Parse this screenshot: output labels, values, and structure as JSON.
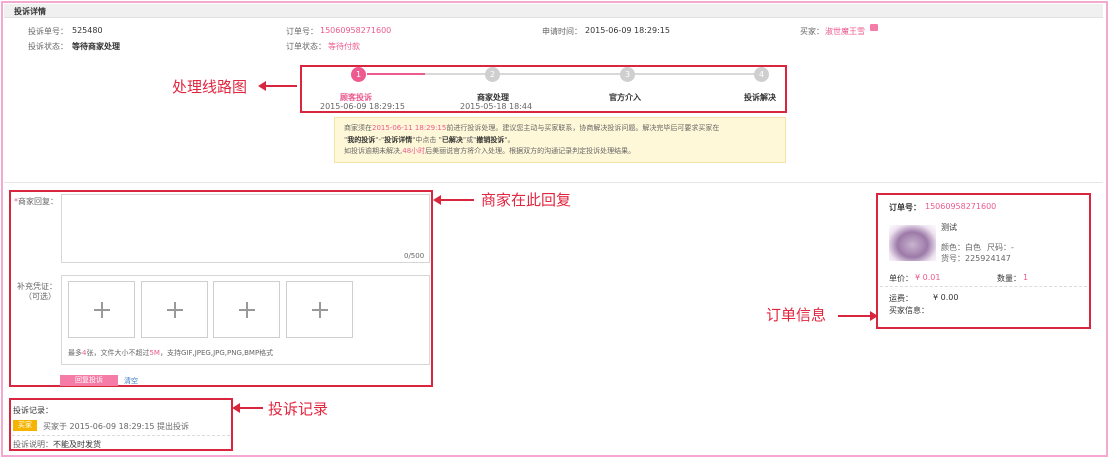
{
  "header": {
    "title": "投诉详情"
  },
  "info": {
    "complaint_no_label": "投诉单号：",
    "complaint_no": "525480",
    "order_no_label": "订单号：",
    "order_no": "15060958271600",
    "apply_time_label": "申请时间：",
    "apply_time": "2015-06-09 18:29:15",
    "buyer_label": "买家：",
    "buyer": "淑世魔王雪",
    "complaint_status_label": "投诉状态：",
    "complaint_status": "等待商家处理",
    "order_status_label": "订单状态：",
    "order_status": "等待付款"
  },
  "steps": [
    {
      "num": "1",
      "label": "顾客投诉",
      "date": "2015-06-09 18:29:15",
      "active": true
    },
    {
      "num": "2",
      "label": "商家处理",
      "date": "2015-05-18 18:44",
      "active": false
    },
    {
      "num": "3",
      "label": "官方介入",
      "date": "",
      "active": false
    },
    {
      "num": "4",
      "label": "投诉解决",
      "date": "",
      "active": false
    }
  ],
  "notice": {
    "l1_a": "商家须在",
    "l1_deadline": "2015-06-11 18:29:15",
    "l1_b": "前进行投诉处理。建议您主动与买家联系，协商解决投诉问题。解决完毕后可要求买家在",
    "l2_a": "\"",
    "l2_b1": "我的投诉",
    "l2_dash": "\"-\"",
    "l2_b2": "投诉详情",
    "l2_c": "\"中点击 \"",
    "l2_b3": "已解决",
    "l2_or": "\"或\"",
    "l2_b4": "撤销投诉",
    "l2_end": "\"。",
    "l3_a": "如投诉逾期未解决,",
    "l3_hours": "48小时",
    "l3_b": "后美丽说官方将介入处理。根据双方的沟通记录判定投诉处理结果。"
  },
  "reply": {
    "star": "*",
    "label": "商家回复：",
    "counter": "0/500",
    "evidence_label": "补充凭证：",
    "evidence_optional": "（可选）",
    "upload_hint_a": "最多",
    "upload_max": "4",
    "upload_hint_b": "张，文件大小不超过",
    "upload_size": "5M",
    "upload_hint_c": "，支持GIF,JPEG,JPG,PNG,BMP格式",
    "submit": "回复投诉",
    "clear": "清空"
  },
  "record": {
    "title": "投诉记录：",
    "badge": "买家",
    "entry": "买家于 2015-06-09 18:29:15 提出投诉",
    "desc_label": "投诉说明：",
    "desc": "不能及时发货"
  },
  "order": {
    "no_label": "订单号：",
    "no": "15060958271600",
    "product_name": "测试",
    "color_label": "颜色：",
    "color": "白色",
    "size_label": "尺码：",
    "size": "-",
    "sku_label": "货号：",
    "sku": "225924147",
    "price_label": "单价：",
    "price": "¥ 0.01",
    "qty_label": "数量：",
    "qty": "1",
    "shipping_label": "运费：",
    "shipping": "¥ 0.00",
    "buyer_info_label": "买家信息："
  },
  "annotations": {
    "route": "处理线路图",
    "reply_here": "商家在此回复",
    "record": "投诉记录",
    "order_info": "订单信息"
  },
  "colors": {
    "accent": "#ec5a8f",
    "annotation": "#e1263f",
    "frame": "#f3a9d0",
    "badge": "#f5b400"
  }
}
